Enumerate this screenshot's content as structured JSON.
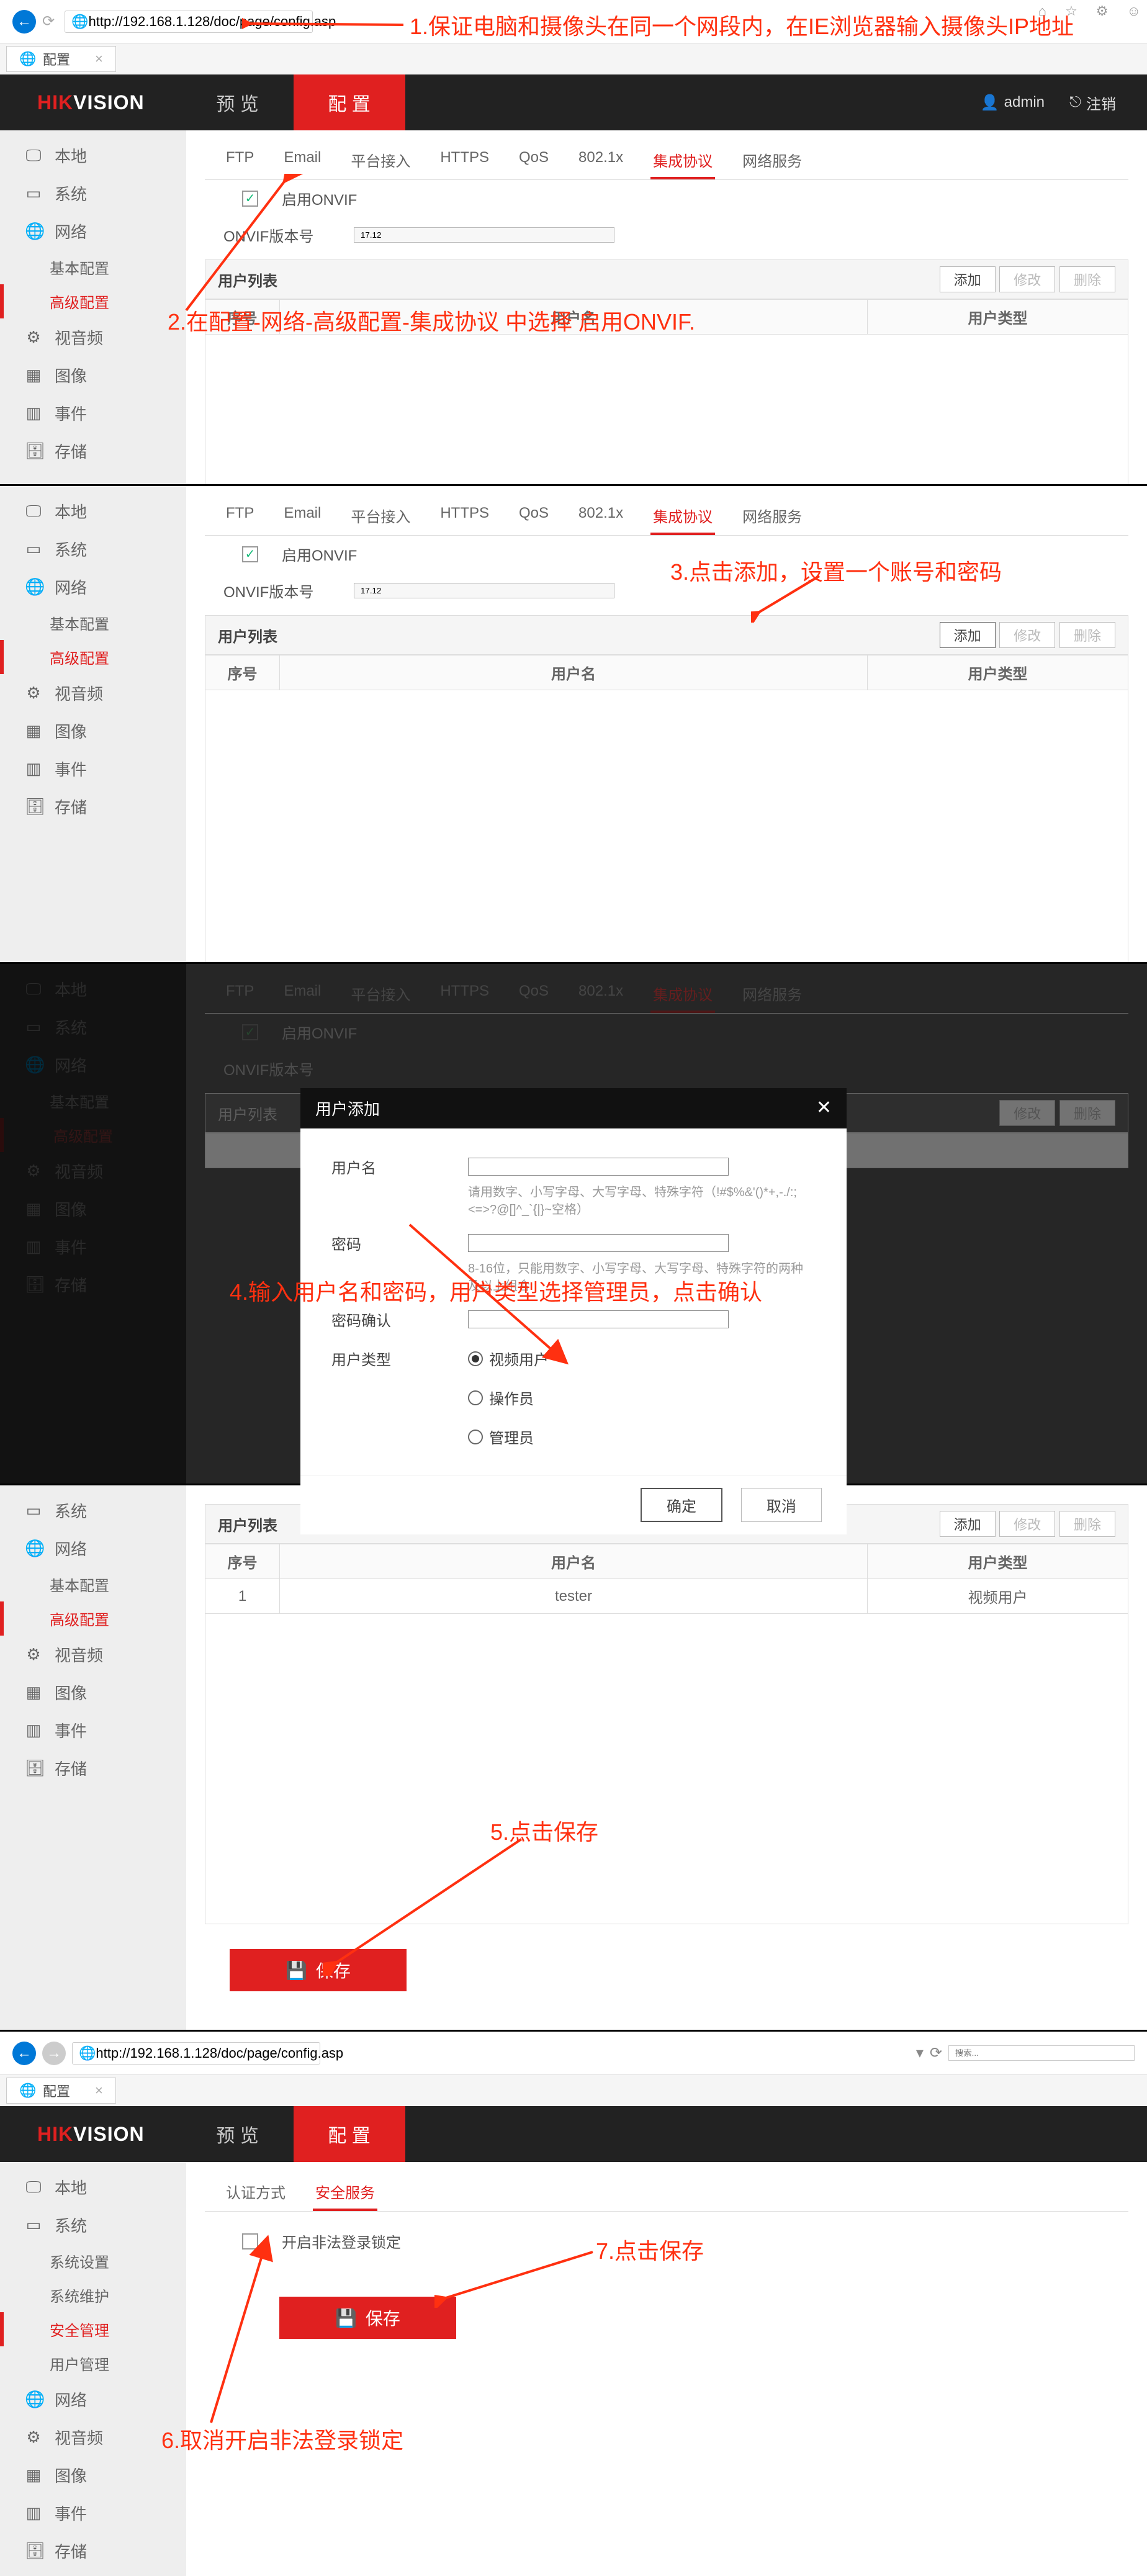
{
  "browser": {
    "url": "http://192.168.1.128/doc/page/config.asp",
    "tab_title": "配置",
    "search_placeholder": "搜索...",
    "url2": "http://192.168.1.128/doc/page/config.asp"
  },
  "header": {
    "brand_prefix": "HIK",
    "brand_suffix": "VISION",
    "nav_preview": "预 览",
    "nav_config": "配 置",
    "user": "admin",
    "logout": "注销"
  },
  "sidebar": {
    "local": "本地",
    "system": "系统",
    "system_settings": "系统设置",
    "system_maint": "系统维护",
    "security": "安全管理",
    "user_mgmt": "用户管理",
    "network": "网络",
    "basic_cfg": "基本配置",
    "adv_cfg": "高级配置",
    "av": "视音频",
    "image": "图像",
    "event": "事件",
    "storage": "存储"
  },
  "subtabs": {
    "ftp": "FTP",
    "email": "Email",
    "platform": "平台接入",
    "https": "HTTPS",
    "qos": "QoS",
    "dot1x": "802.1x",
    "integration": "集成协议",
    "netservice": "网络服务",
    "auth": "认证方式",
    "secservice": "安全服务"
  },
  "onvif": {
    "enable_label": "启用ONVIF",
    "version_label": "ONVIF版本号",
    "version_value": "17.12"
  },
  "userlist": {
    "title": "用户列表",
    "add": "添加",
    "modify": "修改",
    "delete": "删除",
    "col_no": "序号",
    "col_username": "用户名",
    "col_usertype": "用户类型",
    "row1_no": "1",
    "row1_name": "tester",
    "row1_type": "视频用户"
  },
  "dialog": {
    "title": "用户添加",
    "username": "用户名",
    "hint1": "请用数字、小写字母、大写字母、特殊字符（!#$%&'()*+,-./:;<=>?@[]^_`{|}~空格）",
    "password": "密码",
    "hint2": "8-16位，只能用数字、小写字母、大写字母、特殊字符的两种及以上组合",
    "confirm": "密码确认",
    "usertype": "用户类型",
    "type_video": "视频用户",
    "type_operator": "操作员",
    "type_admin": "管理员",
    "ok": "确定",
    "cancel": "取消"
  },
  "security": {
    "lock_label": "开启非法登录锁定"
  },
  "save_btn": "保存",
  "annotations": {
    "a1": "1.保证电脑和摄像头在同一个网段内，在IE浏览器输入摄像头IP地址",
    "a2": "2.在配置-网络-高级配置-集成协议 中选择 启用ONVIF.",
    "a3": "3.点击添加，设置一个账号和密码",
    "a4": "4.输入用户名和密码，用户类型选择管理员，点击确认",
    "a5": "5.点击保存",
    "a6": "6.取消开启非法登录锁定",
    "a7": "7.点击保存"
  }
}
